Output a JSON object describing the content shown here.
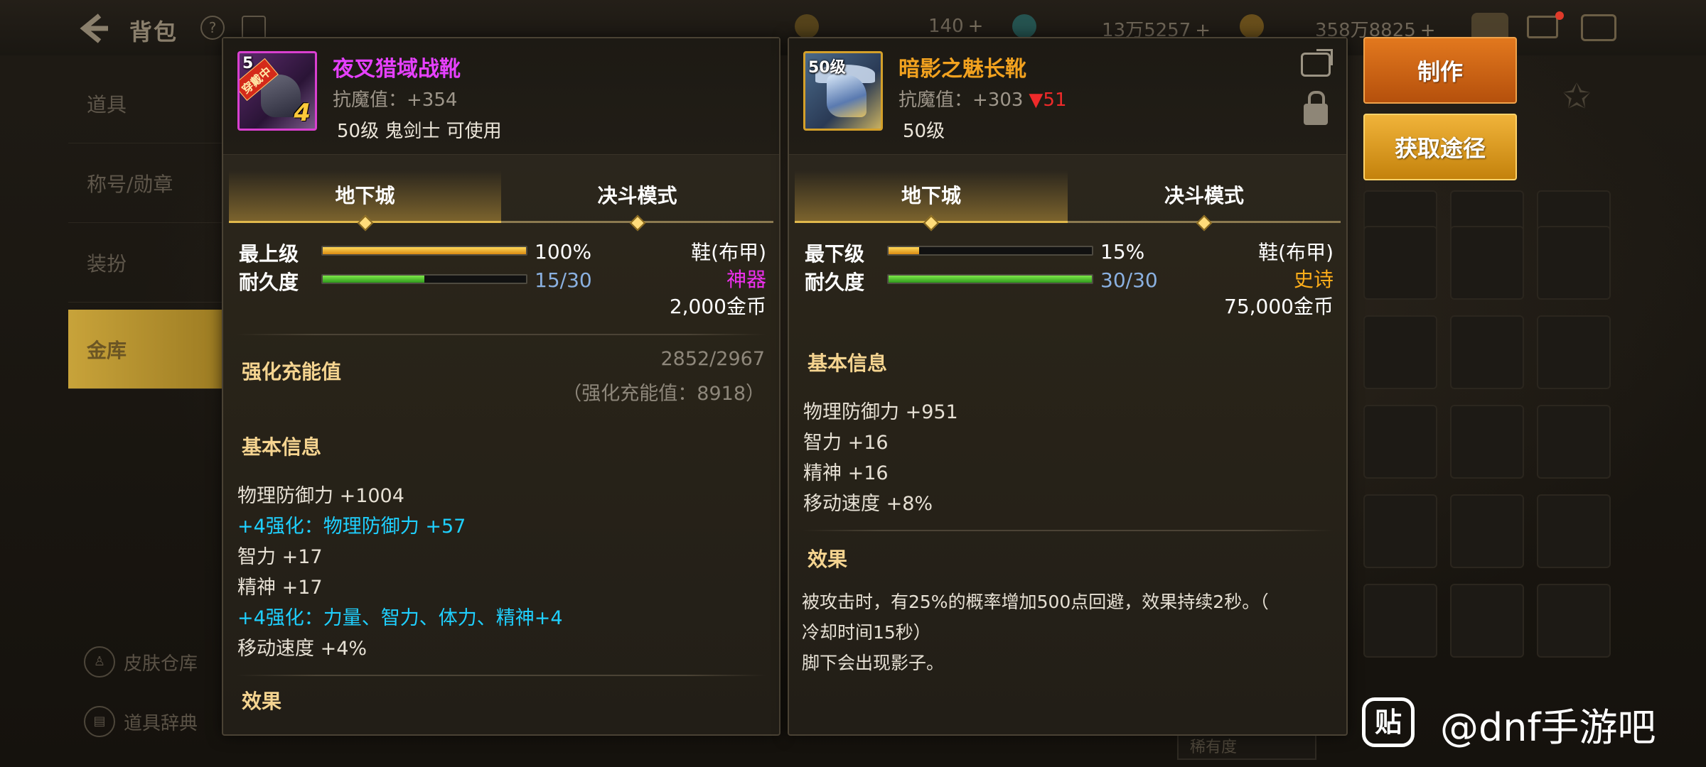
{
  "topbar": {
    "title": "背包",
    "res1_value": "140",
    "res2_value": "13万5257",
    "res3_value": "358万8825",
    "plus": "+"
  },
  "sidebar": {
    "items": [
      {
        "label": "道具"
      },
      {
        "label": "称号/勋章"
      },
      {
        "label": "装扮"
      },
      {
        "label": "金库"
      }
    ],
    "bottom": [
      {
        "label": "皮肤仓库"
      },
      {
        "label": "道具辞典"
      }
    ]
  },
  "left_item": {
    "level_tag": "5",
    "equipped_badge": "穿戴中",
    "enhance_badge": "4",
    "name": "夜叉猎域战靴",
    "resist": "抗魔值：+354",
    "requirement": "50级 鬼剑士 可使用",
    "tabs": [
      "地下城",
      "决斗模式"
    ],
    "stat1_label": "最上级",
    "stat1_value": "100%",
    "stat1_fill": 1.0,
    "stat2_label": "耐久度",
    "stat2_value": "15/30",
    "stat2_fill": 0.5,
    "slot": "鞋(布甲)",
    "grade": "神器",
    "price": "2,000金币",
    "charge_title": "强化充能值",
    "charge_value": "2852/2967",
    "charge_note": "（强化充能值：8918）",
    "basic_title": "基本信息",
    "basic_lines": [
      {
        "text": "物理防御力 +1004",
        "type": "normal"
      },
      {
        "text": "+4强化：物理防御力 +57",
        "type": "enhance"
      },
      {
        "text": "智力 +17",
        "type": "normal"
      },
      {
        "text": "精神 +17",
        "type": "normal"
      },
      {
        "text": "+4强化：力量、智力、体力、精神+4",
        "type": "enhance"
      },
      {
        "text": "移动速度 +4%",
        "type": "normal"
      }
    ],
    "effect_title": "效果"
  },
  "right_item": {
    "level_tag": "50级",
    "name": "暗影之魅长靴",
    "resist": "抗魔值：+303",
    "resist_diff": "▼51",
    "requirement": "50级",
    "tabs": [
      "地下城",
      "决斗模式"
    ],
    "stat1_label": "最下级",
    "stat1_value": "15%",
    "stat1_fill": 0.15,
    "stat2_label": "耐久度",
    "stat2_value": "30/30",
    "stat2_fill": 1.0,
    "slot": "鞋(布甲)",
    "grade": "史诗",
    "price": "75,000金币",
    "basic_title": "基本信息",
    "basic_lines": [
      {
        "text": "物理防御力 +951",
        "type": "normal"
      },
      {
        "text": "智力 +16",
        "type": "normal"
      },
      {
        "text": "精神 +16",
        "type": "normal"
      },
      {
        "text": "移动速度 +8%",
        "type": "normal"
      }
    ],
    "effect_title": "效果",
    "effect_lines": [
      "被攻击时，有25%的概率增加500点回避，效果持续2秒。（",
      "冷却时间15秒）",
      "脚下会出现影子。"
    ]
  },
  "buttons": {
    "craft": "制作",
    "source": "获取途径"
  },
  "background": {
    "sort_label": "稀有度"
  },
  "watermark": {
    "icon_text": "贴",
    "text": "@dnf手游吧"
  },
  "colors": {
    "myth": "#f030f0",
    "epic": "#ffae1a",
    "enhance": "#1fd0ff",
    "down_arrow": "#ee2a2a"
  }
}
